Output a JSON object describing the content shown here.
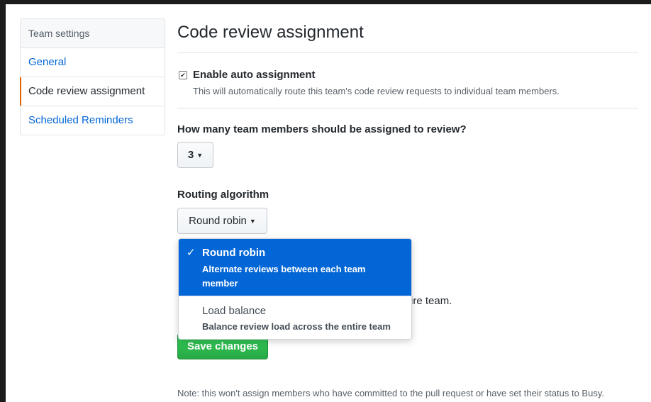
{
  "sidebar": {
    "header": "Team settings",
    "items": [
      {
        "label": "General"
      },
      {
        "label": "Code review assignment"
      },
      {
        "label": "Scheduled Reminders"
      }
    ]
  },
  "main": {
    "title": "Code review assignment",
    "auto_assign": {
      "checked": true,
      "check_glyph": "✔",
      "label": "Enable auto assignment",
      "description": "This will automatically route this team's code review requests to individual team members."
    },
    "member_count": {
      "question": "How many team members should be assigned to review?",
      "selected": "3",
      "caret": "▼"
    },
    "routing": {
      "label": "Routing algorithm",
      "selected": "Round robin",
      "caret": "▼",
      "partially_hidden_text": "ire team.",
      "options": [
        {
          "title": "Round robin",
          "description": "Alternate reviews between each team member",
          "selected": true,
          "check_glyph": "✓"
        },
        {
          "title": "Load balance",
          "description": "Balance review load across the entire team",
          "selected": false
        }
      ]
    },
    "save_label": "Save changes",
    "note": "Note: this won't assign members who have committed to the pull request or have set their status to Busy."
  },
  "colors": {
    "link": "#0366d6",
    "selected_marker": "#e36209",
    "primary_button": "#28a745",
    "menu_active": "#0366d6"
  }
}
